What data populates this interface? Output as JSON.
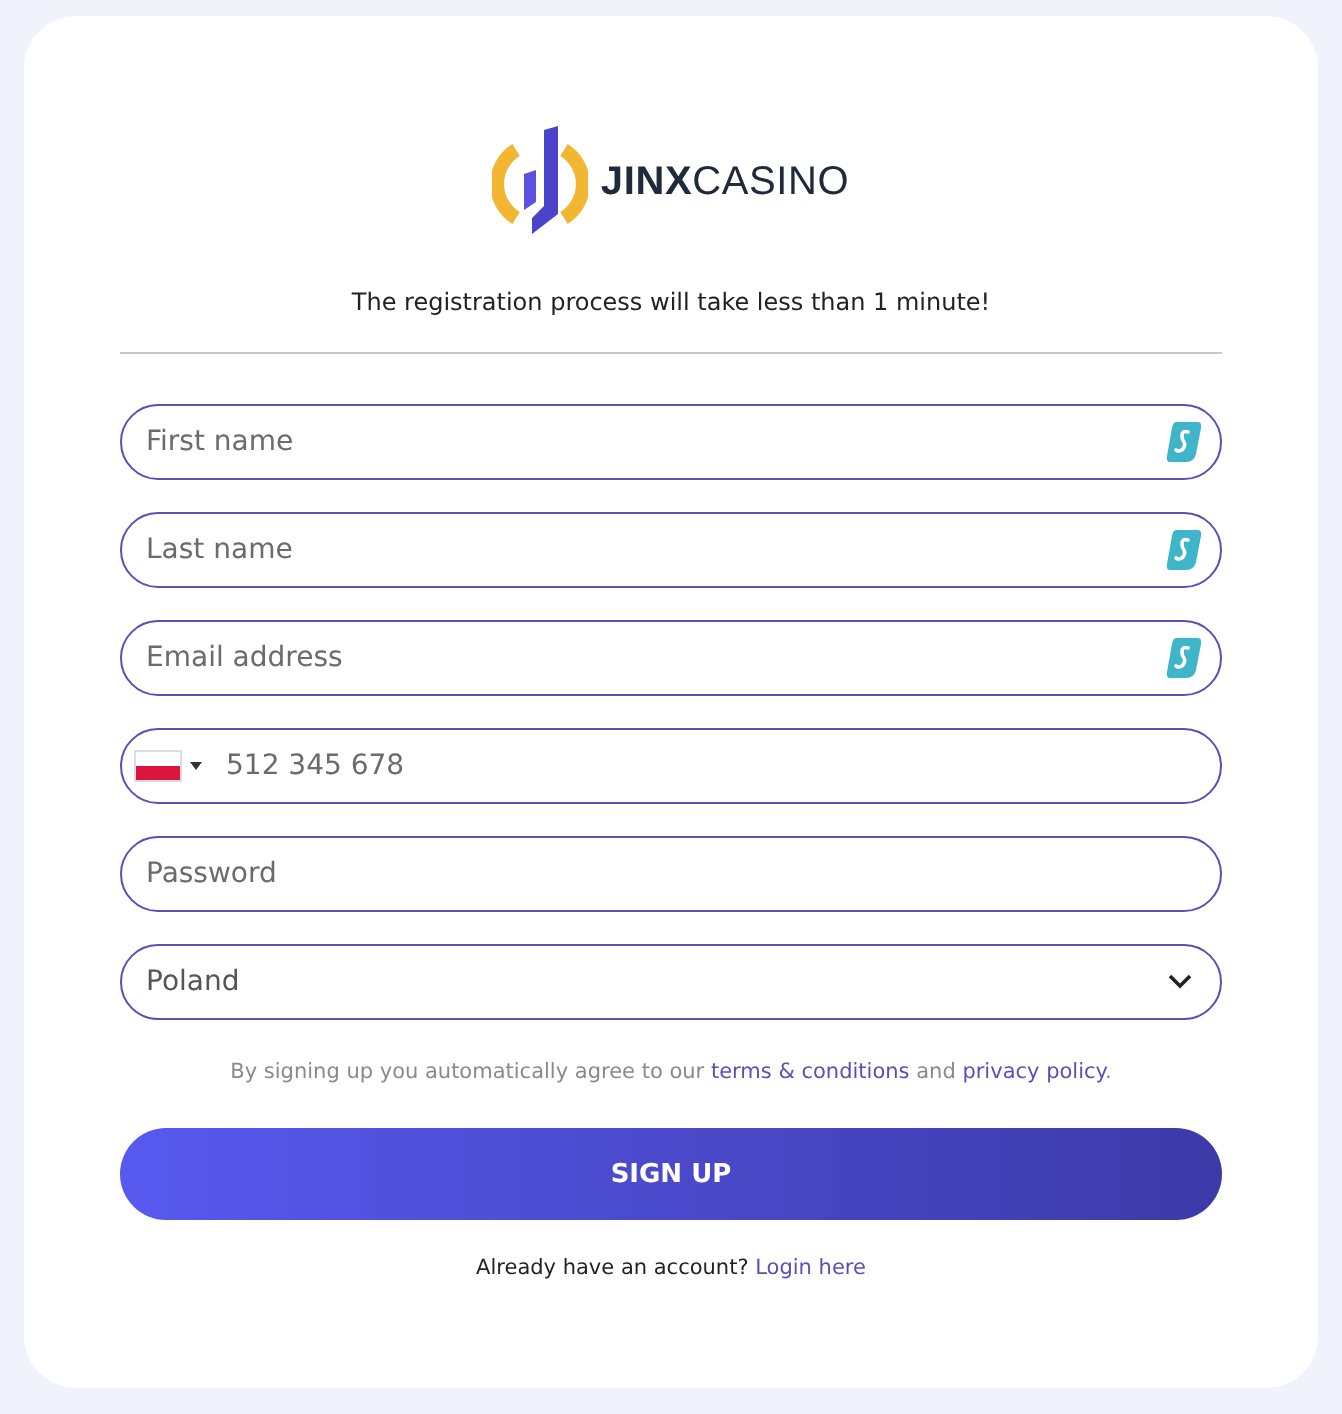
{
  "logo": {
    "text": "**JINX**CASINO"
  },
  "subtitle": "The registration process will take less than 1 minute!",
  "fields": [
    {
      "kind": "text",
      "placeholder": "First name",
      "autofill_icon": true
    },
    {
      "kind": "text",
      "placeholder": "Last name",
      "autofill_icon": true
    },
    {
      "kind": "text",
      "placeholder": "Email address",
      "autofill_icon": true
    },
    {
      "kind": "phone",
      "placeholder": "512 345 678"
    },
    {
      "kind": "password",
      "placeholder": "Password"
    },
    {
      "kind": "select",
      "value": "Poland"
    }
  ],
  "terms": {
    "before": "By signing up you automatically agree to our",
    "link1": "terms & conditions",
    "middle": "and",
    "link2": "privacy policy",
    "after": "."
  },
  "submit": "SIGN UP",
  "login": {
    "text": "Already have an account?",
    "link": "Login here"
  }
}
